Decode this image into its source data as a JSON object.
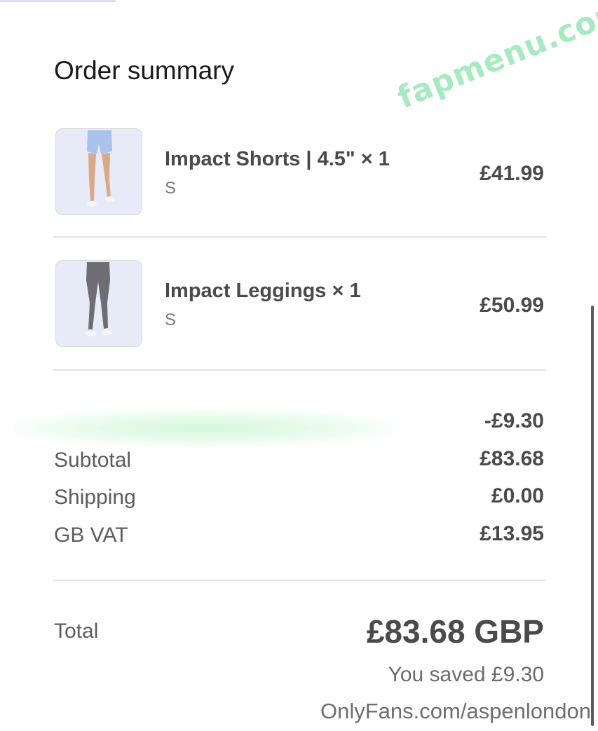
{
  "watermarks": {
    "top": "fapmenu.com",
    "bottom": "OnlyFans.com/aspenlondon"
  },
  "order_summary": {
    "title": "Order summary",
    "items": [
      {
        "name": "Impact Shorts | 4.5\" × 1",
        "variant": "S",
        "price": "£41.99",
        "image_icon": "shorts-product-image"
      },
      {
        "name": "Impact Leggings × 1",
        "variant": "S",
        "price": "£50.99",
        "image_icon": "leggings-product-image"
      }
    ],
    "discount": {
      "value": "-£9.30"
    },
    "subtotal": {
      "label": "Subtotal",
      "value": "£83.68"
    },
    "shipping": {
      "label": "Shipping",
      "value": "£0.00"
    },
    "vat": {
      "label": "GB VAT",
      "value": "£13.95"
    },
    "total": {
      "label": "Total",
      "value": "£83.68 GBP"
    },
    "saved": "You saved £9.30"
  },
  "colors": {
    "text_dark": "#4a4a4a",
    "watermark_green": "#a7eac2",
    "divider": "#e3e3e3"
  }
}
